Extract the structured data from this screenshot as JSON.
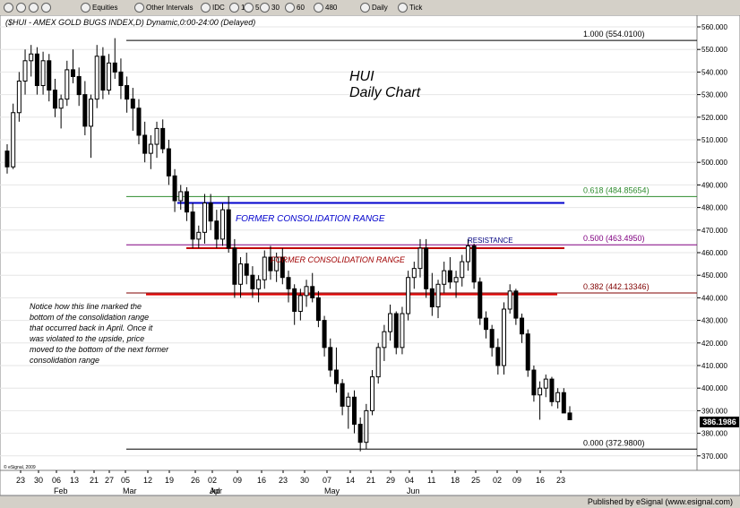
{
  "toolbar": {
    "items": [
      {
        "icon": "nav-up-icon",
        "label": ""
      },
      {
        "icon": "home-icon",
        "label": ""
      },
      {
        "icon": "cursor-icon",
        "label": ""
      },
      {
        "icon": "crosshair-icon",
        "label": ""
      },
      {
        "icon": "dropdown-icon",
        "label": "Equities"
      },
      {
        "icon": "dropdown-icon",
        "label": "Other Intervals"
      },
      {
        "icon": "s-icon",
        "label": "IDC"
      },
      {
        "icon": "interval-icon",
        "label": "1"
      },
      {
        "icon": "interval-icon",
        "label": "5"
      },
      {
        "icon": "interval-icon",
        "label": "30"
      },
      {
        "icon": "interval-icon",
        "label": "60"
      },
      {
        "icon": "interval-icon",
        "label": "480"
      },
      {
        "icon": "interval-icon",
        "label": "Daily"
      },
      {
        "icon": "interval-icon",
        "label": "Tick"
      }
    ]
  },
  "footer": {
    "text": "Published by eSignal (www.esignal.com)"
  },
  "chart_data": {
    "type": "candlestick",
    "header": "($HUI - AMEX GOLD BUGS INDEX,D) Dynamic,0:00-24:00 (Delayed)",
    "annotation_title": [
      "HUI",
      "Daily Chart"
    ],
    "watermark": "© eSignal, 2009",
    "ylim": [
      365,
      565
    ],
    "yticks": [
      370,
      380,
      390,
      400,
      410,
      420,
      430,
      440,
      450,
      460,
      470,
      480,
      490,
      500,
      510,
      520,
      530,
      540,
      550,
      560
    ],
    "ytick_labels": [
      "370.000",
      "380.000",
      "390.000",
      "400.000",
      "410.000",
      "420.000",
      "430.000",
      "440.000",
      "450.000",
      "460.000",
      "470.000",
      "480.000",
      "490.000",
      "500.000",
      "510.000",
      "520.000",
      "530.000",
      "540.000",
      "550.000",
      "560.000"
    ],
    "last_price": "386.1986",
    "x_day_labels": [
      "23",
      "30",
      "06",
      "13",
      "21",
      "27",
      "05",
      "12",
      "19",
      "26",
      "02",
      "09",
      "16",
      "23",
      "30",
      "07",
      "14",
      "21",
      "29",
      "04",
      "11",
      "18",
      "25",
      "02",
      "09",
      "16",
      "23"
    ],
    "month_labels": [
      {
        "label": "Feb",
        "at": "06"
      },
      {
        "label": "Mar",
        "at": "05"
      },
      {
        "label": "Apr",
        "at": "02"
      },
      {
        "label": "May",
        "at": "07"
      },
      {
        "label": "Jun",
        "at": "04"
      },
      {
        "label": "Jul",
        "at": "02"
      }
    ],
    "fib_levels": [
      {
        "label": "1.000 (554.0100)",
        "value": 554.01,
        "color": "#000000"
      },
      {
        "label": "0.618 (484.85654)",
        "value": 484.85654,
        "color": "#2e8b2e"
      },
      {
        "label": "0.500 (463.4950)",
        "value": 463.495,
        "color": "#800080"
      },
      {
        "label": "0.382 (442.13346)",
        "value": 442.13346,
        "color": "#800000"
      },
      {
        "label": "0.000 (372.9800)",
        "value": 372.98,
        "color": "#000000"
      }
    ],
    "consolidation_lines": [
      {
        "label": "FORMER CONSOLIDATION RANGE",
        "value": 482,
        "color": "#0000cc"
      },
      {
        "label": "FORMER CONSOLIDATION RANGE",
        "value": 462,
        "color": "#c00000"
      },
      {
        "label": "",
        "value": 441.5,
        "color": "#e00000"
      }
    ],
    "resistance_label": "RESISTANCE",
    "note": [
      "Notice how this line marked the",
      "bottom of the consolidation range",
      "that occurred back in April. Once it",
      "was violated to the upside, price",
      "moved to the bottom of the next former",
      "consolidation range"
    ],
    "candles": [
      [
        505,
        508,
        495,
        498
      ],
      [
        498,
        526,
        497,
        522
      ],
      [
        522,
        540,
        518,
        536
      ],
      [
        536,
        550,
        530,
        545
      ],
      [
        545,
        552,
        538,
        548
      ],
      [
        548,
        551,
        530,
        534
      ],
      [
        534,
        549,
        530,
        545
      ],
      [
        545,
        548,
        527,
        532
      ],
      [
        532,
        537,
        520,
        524
      ],
      [
        524,
        530,
        515,
        528
      ],
      [
        528,
        545,
        525,
        541
      ],
      [
        541,
        550,
        535,
        538
      ],
      [
        538,
        542,
        525,
        530
      ],
      [
        530,
        536,
        512,
        516
      ],
      [
        516,
        530,
        502,
        528
      ],
      [
        528,
        552,
        524,
        547
      ],
      [
        547,
        551,
        528,
        532
      ],
      [
        532,
        548,
        530,
        544
      ],
      [
        544,
        555,
        537,
        540
      ],
      [
        540,
        546,
        528,
        534
      ],
      [
        534,
        538,
        522,
        528
      ],
      [
        528,
        533,
        514,
        524
      ],
      [
        524,
        528,
        508,
        512
      ],
      [
        512,
        518,
        500,
        504
      ],
      [
        504,
        512,
        497,
        508
      ],
      [
        508,
        518,
        502,
        515
      ],
      [
        515,
        519,
        504,
        506
      ],
      [
        506,
        510,
        490,
        494
      ],
      [
        494,
        497,
        478,
        483
      ],
      [
        483,
        490,
        479,
        487
      ],
      [
        487,
        489,
        474,
        478
      ],
      [
        478,
        482,
        462,
        466
      ],
      [
        466,
        472,
        462,
        469
      ],
      [
        469,
        486,
        464,
        482
      ],
      [
        482,
        486,
        470,
        474
      ],
      [
        474,
        479,
        462,
        466
      ],
      [
        466,
        482,
        463,
        479
      ],
      [
        479,
        485,
        460,
        462
      ],
      [
        462,
        466,
        440,
        446
      ],
      [
        446,
        458,
        440,
        455
      ],
      [
        455,
        460,
        446,
        450
      ],
      [
        450,
        454,
        440,
        444
      ],
      [
        444,
        450,
        438,
        448
      ],
      [
        448,
        461,
        444,
        458
      ],
      [
        458,
        463,
        448,
        452
      ],
      [
        452,
        460,
        447,
        458
      ],
      [
        458,
        462,
        446,
        449
      ],
      [
        449,
        452,
        438,
        444
      ],
      [
        444,
        446,
        428,
        434
      ],
      [
        434,
        444,
        430,
        441
      ],
      [
        441,
        448,
        436,
        445
      ],
      [
        445,
        451,
        438,
        440
      ],
      [
        440,
        443,
        427,
        430
      ],
      [
        430,
        432,
        414,
        418
      ],
      [
        418,
        422,
        405,
        408
      ],
      [
        408,
        418,
        398,
        402
      ],
      [
        402,
        404,
        388,
        392
      ],
      [
        392,
        398,
        382,
        396
      ],
      [
        396,
        399,
        380,
        384
      ],
      [
        384,
        387,
        372,
        376
      ],
      [
        376,
        393,
        373,
        390
      ],
      [
        390,
        408,
        388,
        405
      ],
      [
        405,
        420,
        402,
        418
      ],
      [
        418,
        428,
        412,
        425
      ],
      [
        425,
        437,
        421,
        433
      ],
      [
        433,
        434,
        415,
        418
      ],
      [
        418,
        436,
        415,
        433
      ],
      [
        433,
        452,
        430,
        449
      ],
      [
        449,
        456,
        444,
        453
      ],
      [
        453,
        466,
        449,
        462
      ],
      [
        462,
        466,
        440,
        444
      ],
      [
        444,
        451,
        432,
        436
      ],
      [
        436,
        448,
        431,
        446
      ],
      [
        446,
        456,
        442,
        452
      ],
      [
        452,
        458,
        444,
        447
      ],
      [
        447,
        452,
        440,
        449
      ],
      [
        449,
        459,
        445,
        456
      ],
      [
        456,
        466,
        452,
        463
      ],
      [
        463,
        464,
        444,
        447
      ],
      [
        447,
        449,
        428,
        431
      ],
      [
        431,
        434,
        422,
        426
      ],
      [
        426,
        428,
        414,
        418
      ],
      [
        418,
        422,
        406,
        410
      ],
      [
        410,
        438,
        406,
        435
      ],
      [
        435,
        446,
        433,
        443
      ],
      [
        443,
        444,
        428,
        431
      ],
      [
        431,
        433,
        420,
        424
      ],
      [
        424,
        426,
        405,
        408
      ],
      [
        408,
        410,
        394,
        397
      ],
      [
        397,
        403,
        386,
        400
      ],
      [
        400,
        406,
        396,
        404
      ],
      [
        404,
        405,
        392,
        394
      ],
      [
        394,
        400,
        391,
        398
      ],
      [
        398,
        400,
        390,
        389
      ],
      [
        389,
        392,
        386,
        386
      ]
    ]
  }
}
